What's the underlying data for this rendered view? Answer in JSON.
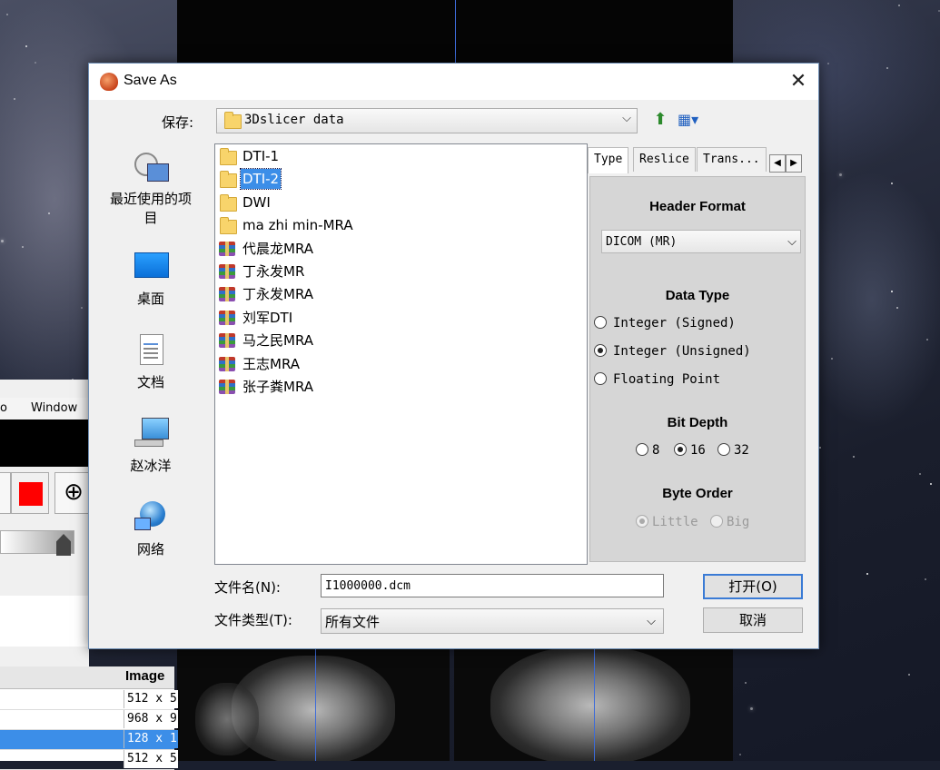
{
  "background_app": {
    "menu_left": "o",
    "menu_window": "Window",
    "table_header": "Image",
    "table_rows": [
      "512 x 5",
      "968 x 9",
      "128 x 1",
      "512 x 5"
    ],
    "selected_row": 2
  },
  "dialog": {
    "title": "Save As",
    "save_in_label": "保存:",
    "save_in_value": "3Dslicer data",
    "places": [
      {
        "label": "最近使用的项目",
        "icon": "recent-places-icon"
      },
      {
        "label": "桌面",
        "icon": "desktop-icon"
      },
      {
        "label": "文档",
        "icon": "documents-icon"
      },
      {
        "label": "赵冰洋",
        "icon": "computer-icon"
      },
      {
        "label": "网络",
        "icon": "network-icon"
      }
    ],
    "files": [
      {
        "name": "DTI-1",
        "type": "folder",
        "selected": false
      },
      {
        "name": "DTI-2",
        "type": "folder",
        "selected": true
      },
      {
        "name": "DWI",
        "type": "folder",
        "selected": false
      },
      {
        "name": "ma zhi min-MRA",
        "type": "folder",
        "selected": false
      },
      {
        "name": "代晨龙MRA",
        "type": "archive",
        "selected": false
      },
      {
        "name": "丁永发MR",
        "type": "archive",
        "selected": false
      },
      {
        "name": "丁永发MRA",
        "type": "archive",
        "selected": false
      },
      {
        "name": "刘军DTI",
        "type": "archive",
        "selected": false
      },
      {
        "name": "马之民MRA",
        "type": "archive",
        "selected": false
      },
      {
        "name": "王志MRA",
        "type": "archive",
        "selected": false
      },
      {
        "name": "张子粪MRA",
        "type": "archive",
        "selected": false
      }
    ],
    "tabs": [
      "Type",
      "Reslice",
      "Trans..."
    ],
    "active_tab": 0,
    "options": {
      "header_format_title": "Header Format",
      "header_format_value": "DICOM (MR)",
      "data_type_title": "Data Type",
      "data_types": [
        {
          "label": "Integer (Signed)",
          "checked": false
        },
        {
          "label": "Integer (Unsigned)",
          "checked": true
        },
        {
          "label": "Floating Point",
          "checked": false
        }
      ],
      "bit_depth_title": "Bit Depth",
      "bit_depths": [
        {
          "label": "8",
          "checked": false
        },
        {
          "label": "16",
          "checked": true
        },
        {
          "label": "32",
          "checked": false
        }
      ],
      "byte_order_title": "Byte Order",
      "byte_orders": [
        {
          "label": "Little",
          "checked": true
        },
        {
          "label": "Big",
          "checked": false
        }
      ],
      "byte_order_disabled": true
    },
    "file_name_label": "文件名(N):",
    "file_name_value": "I1000000.dcm",
    "file_type_label": "文件类型(T):",
    "file_type_value": "所有文件",
    "open_button": "打开(O)",
    "cancel_button": "取消"
  },
  "colors": {
    "selection": "#3c8ee8",
    "slice_line": "#3d6bd8",
    "red_swatch": "#ff0000"
  }
}
